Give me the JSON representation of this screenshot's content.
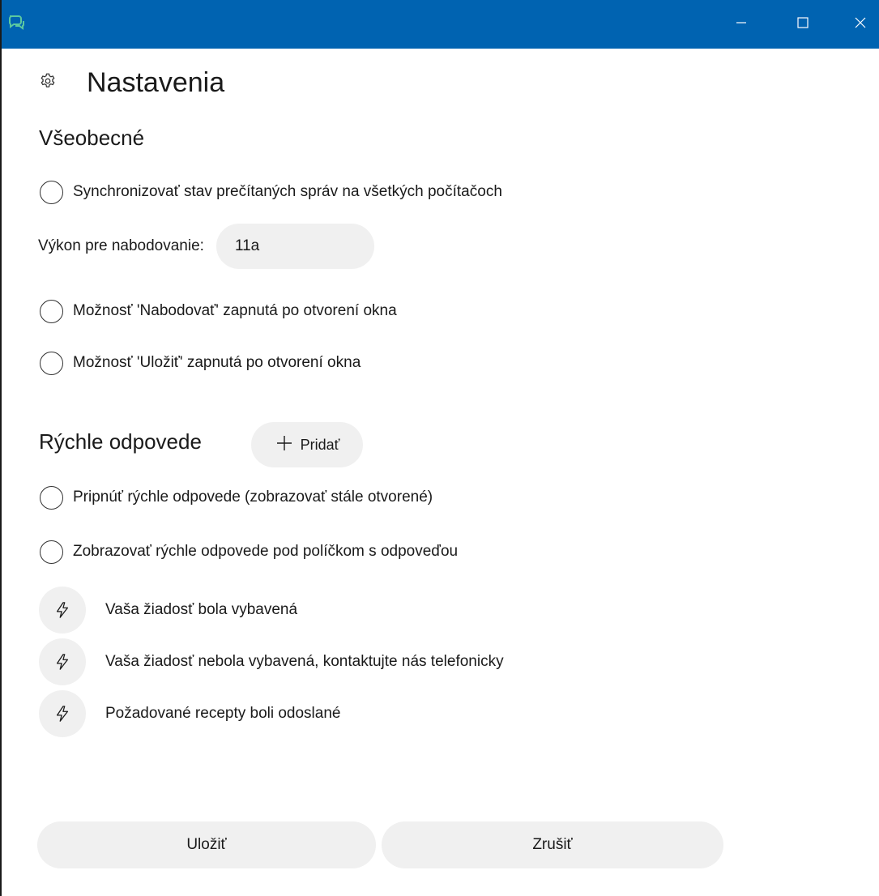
{
  "titlebar": {
    "icons": {
      "app": "chat-bubbles-icon",
      "minimize": "minimize-icon",
      "maximize": "maximize-icon",
      "close": "close-icon"
    },
    "bg_color": "#0063b1",
    "icon_color": "#5bc8a0"
  },
  "header": {
    "title": "Nastavenia",
    "icon": "gear-icon"
  },
  "general": {
    "title": "Všeobecné",
    "sync_label": "Synchronizovať stav prečítaných správ na všetkých počítačoch",
    "scoring_label": "Výkon pre nabodovanie:",
    "scoring_value": "11a",
    "score_on_open_label": "Možnosť 'Nabodovať' zapnutá po otvorení okna",
    "save_on_open_label": "Možnosť 'Uložiť' zapnutá po otvorení okna"
  },
  "quick_replies": {
    "title": "Rýchle odpovede",
    "add_label": "Pridať",
    "pin_label": "Pripnúť rýchle odpovede (zobrazovať stále otvorené)",
    "show_below_label": "Zobrazovať rýchle odpovede pod políčkom s odpoveďou",
    "items": [
      {
        "label": "Vaša žiadosť bola vybavená",
        "icon": "lightning-icon"
      },
      {
        "label": "Vaša žiadosť nebola vybavená, kontaktujte nás telefonicky",
        "icon": "lightning-icon"
      },
      {
        "label": "Požadované recepty boli odoslané",
        "icon": "lightning-icon"
      }
    ]
  },
  "footer": {
    "save_label": "Uložiť",
    "cancel_label": "Zrušiť"
  }
}
